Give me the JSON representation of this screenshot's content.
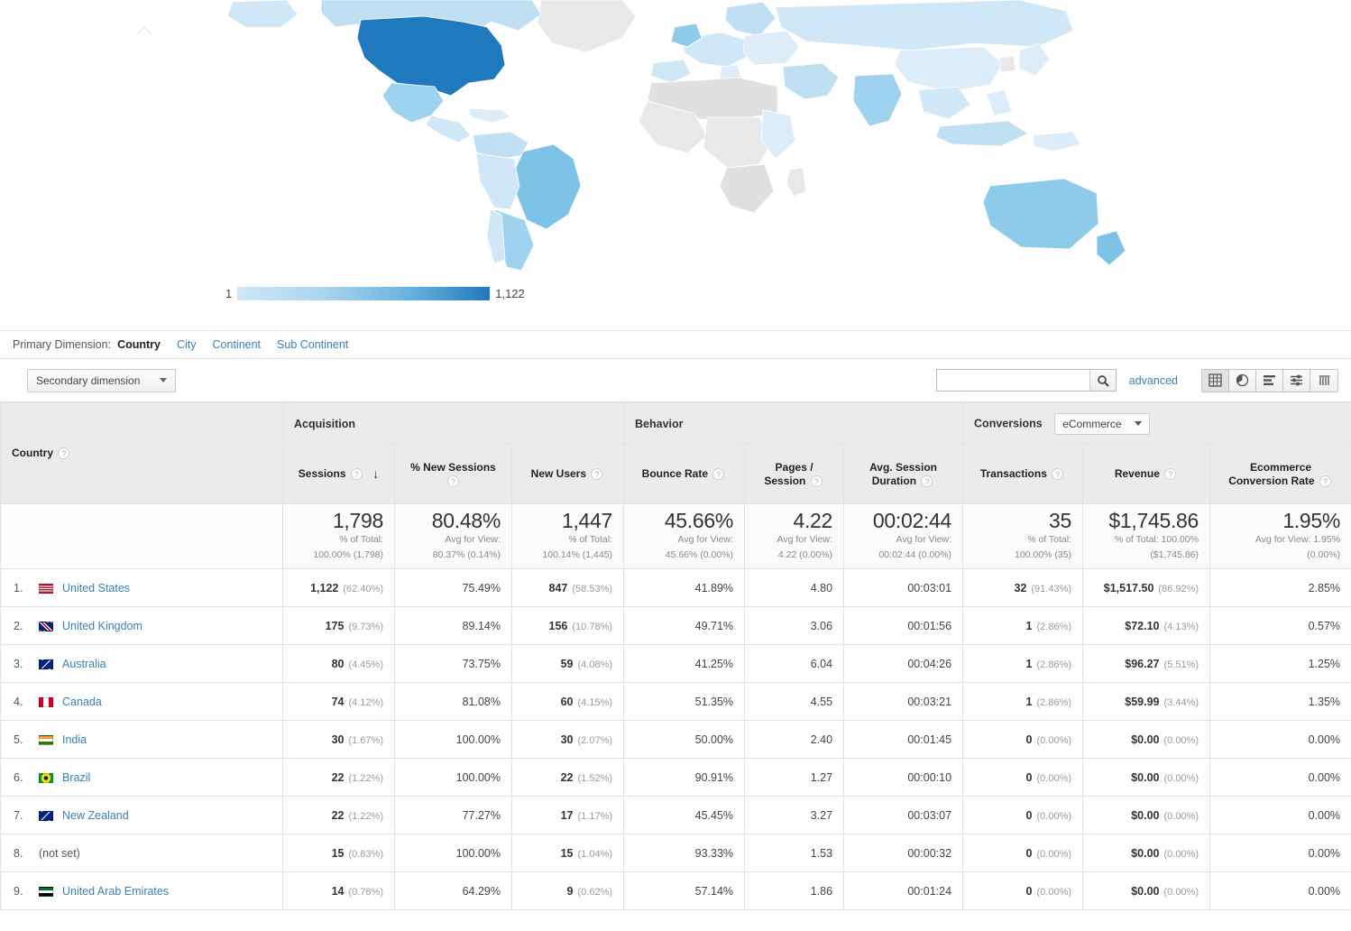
{
  "map": {
    "legend_min": "1",
    "legend_max": "1,122",
    "scale_low_color": "#cfe7f7",
    "scale_high_color": "#1f79bd",
    "no_data_color": "#e8e8e8"
  },
  "primary_dimension": {
    "label": "Primary Dimension:",
    "items": [
      {
        "label": "Country",
        "active": true
      },
      {
        "label": "City",
        "active": false
      },
      {
        "label": "Continent",
        "active": false
      },
      {
        "label": "Sub Continent",
        "active": false
      }
    ]
  },
  "toolbar": {
    "secondary_dimension_label": "Secondary dimension",
    "search_value": "",
    "search_placeholder": "",
    "advanced_label": "advanced",
    "view_icons": [
      {
        "name": "table-view-icon",
        "selected": true
      },
      {
        "name": "pie-chart-view-icon",
        "selected": false
      },
      {
        "name": "performance-view-icon",
        "selected": false
      },
      {
        "name": "comparison-view-icon",
        "selected": false
      },
      {
        "name": "pivot-view-icon",
        "selected": false
      }
    ]
  },
  "table": {
    "dimension_header": "Country",
    "groups": [
      {
        "label": "Acquisition",
        "span": 3
      },
      {
        "label": "Behavior",
        "span": 3
      },
      {
        "label": "Conversions",
        "span": 3,
        "select_value": "eCommerce"
      }
    ],
    "columns": [
      "Sessions",
      "% New Sessions",
      "New Users",
      "Bounce Rate",
      "Pages / Session",
      "Avg. Session Duration",
      "Transactions",
      "Revenue",
      "Ecommerce Conversion Rate"
    ],
    "summary": [
      {
        "value": "1,798",
        "sub1": "% of Total:",
        "sub2": "100.00% (1,798)"
      },
      {
        "value": "80.48%",
        "sub1": "Avg for View:",
        "sub2": "80.37% (0.14%)"
      },
      {
        "value": "1,447",
        "sub1": "% of Total:",
        "sub2": "100.14% (1,445)"
      },
      {
        "value": "45.66%",
        "sub1": "Avg for View:",
        "sub2": "45.66% (0.00%)"
      },
      {
        "value": "4.22",
        "sub1": "Avg for View:",
        "sub2": "4.22 (0.00%)"
      },
      {
        "value": "00:02:44",
        "sub1": "Avg for View:",
        "sub2": "00:02:44 (0.00%)"
      },
      {
        "value": "35",
        "sub1": "% of Total:",
        "sub2": "100.00% (35)"
      },
      {
        "value": "$1,745.86",
        "sub1": "% of Total: 100.00%",
        "sub2": "($1,745.86)"
      },
      {
        "value": "1.95%",
        "sub1": "Avg for View: 1.95%",
        "sub2": "(0.00%)"
      }
    ],
    "rows": [
      {
        "rank": "1.",
        "country": "United States",
        "flag": "us",
        "linked": true,
        "sessions": "1,122",
        "sessions_pct": "(62.40%)",
        "new_sessions_pct": "75.49%",
        "new_users": "847",
        "new_users_pct": "(58.53%)",
        "bounce_rate": "41.89%",
        "pages_session": "4.80",
        "avg_duration": "00:03:01",
        "transactions": "32",
        "transactions_pct": "(91.43%)",
        "revenue": "$1,517.50",
        "revenue_pct": "(86.92%)",
        "ecom_rate": "2.85%"
      },
      {
        "rank": "2.",
        "country": "United Kingdom",
        "flag": "gb",
        "linked": true,
        "sessions": "175",
        "sessions_pct": "(9.73%)",
        "new_sessions_pct": "89.14%",
        "new_users": "156",
        "new_users_pct": "(10.78%)",
        "bounce_rate": "49.71%",
        "pages_session": "3.06",
        "avg_duration": "00:01:56",
        "transactions": "1",
        "transactions_pct": "(2.86%)",
        "revenue": "$72.10",
        "revenue_pct": "(4.13%)",
        "ecom_rate": "0.57%"
      },
      {
        "rank": "3.",
        "country": "Australia",
        "flag": "au",
        "linked": true,
        "sessions": "80",
        "sessions_pct": "(4.45%)",
        "new_sessions_pct": "73.75%",
        "new_users": "59",
        "new_users_pct": "(4.08%)",
        "bounce_rate": "41.25%",
        "pages_session": "6.04",
        "avg_duration": "00:04:26",
        "transactions": "1",
        "transactions_pct": "(2.86%)",
        "revenue": "$96.27",
        "revenue_pct": "(5.51%)",
        "ecom_rate": "1.25%"
      },
      {
        "rank": "4.",
        "country": "Canada",
        "flag": "ca",
        "linked": true,
        "sessions": "74",
        "sessions_pct": "(4.12%)",
        "new_sessions_pct": "81.08%",
        "new_users": "60",
        "new_users_pct": "(4.15%)",
        "bounce_rate": "51.35%",
        "pages_session": "4.55",
        "avg_duration": "00:03:21",
        "transactions": "1",
        "transactions_pct": "(2.86%)",
        "revenue": "$59.99",
        "revenue_pct": "(3.44%)",
        "ecom_rate": "1.35%"
      },
      {
        "rank": "5.",
        "country": "India",
        "flag": "in",
        "linked": true,
        "sessions": "30",
        "sessions_pct": "(1.67%)",
        "new_sessions_pct": "100.00%",
        "new_users": "30",
        "new_users_pct": "(2.07%)",
        "bounce_rate": "50.00%",
        "pages_session": "2.40",
        "avg_duration": "00:01:45",
        "transactions": "0",
        "transactions_pct": "(0.00%)",
        "revenue": "$0.00",
        "revenue_pct": "(0.00%)",
        "ecom_rate": "0.00%"
      },
      {
        "rank": "6.",
        "country": "Brazil",
        "flag": "br",
        "linked": true,
        "sessions": "22",
        "sessions_pct": "(1.22%)",
        "new_sessions_pct": "100.00%",
        "new_users": "22",
        "new_users_pct": "(1.52%)",
        "bounce_rate": "90.91%",
        "pages_session": "1.27",
        "avg_duration": "00:00:10",
        "transactions": "0",
        "transactions_pct": "(0.00%)",
        "revenue": "$0.00",
        "revenue_pct": "(0.00%)",
        "ecom_rate": "0.00%"
      },
      {
        "rank": "7.",
        "country": "New Zealand",
        "flag": "nz",
        "linked": true,
        "sessions": "22",
        "sessions_pct": "(1.22%)",
        "new_sessions_pct": "77.27%",
        "new_users": "17",
        "new_users_pct": "(1.17%)",
        "bounce_rate": "45.45%",
        "pages_session": "3.27",
        "avg_duration": "00:03:07",
        "transactions": "0",
        "transactions_pct": "(0.00%)",
        "revenue": "$0.00",
        "revenue_pct": "(0.00%)",
        "ecom_rate": "0.00%"
      },
      {
        "rank": "8.",
        "country": "(not set)",
        "flag": "",
        "linked": false,
        "sessions": "15",
        "sessions_pct": "(0.83%)",
        "new_sessions_pct": "100.00%",
        "new_users": "15",
        "new_users_pct": "(1.04%)",
        "bounce_rate": "93.33%",
        "pages_session": "1.53",
        "avg_duration": "00:00:32",
        "transactions": "0",
        "transactions_pct": "(0.00%)",
        "revenue": "$0.00",
        "revenue_pct": "(0.00%)",
        "ecom_rate": "0.00%"
      },
      {
        "rank": "9.",
        "country": "United Arab Emirates",
        "flag": "ae",
        "linked": true,
        "sessions": "14",
        "sessions_pct": "(0.78%)",
        "new_sessions_pct": "64.29%",
        "new_users": "9",
        "new_users_pct": "(0.62%)",
        "bounce_rate": "57.14%",
        "pages_session": "1.86",
        "avg_duration": "00:01:24",
        "transactions": "0",
        "transactions_pct": "(0.00%)",
        "revenue": "$0.00",
        "revenue_pct": "(0.00%)",
        "ecom_rate": "0.00%"
      }
    ]
  },
  "chart_data": {
    "type": "heatmap",
    "title": "Sessions by Country (World Map)",
    "metric": "Sessions",
    "scale_min": 1,
    "scale_max": 1122,
    "categories": [
      "United States",
      "United Kingdom",
      "Australia",
      "Canada",
      "India",
      "Brazil",
      "New Zealand",
      "(not set)",
      "United Arab Emirates"
    ],
    "values": [
      1122,
      175,
      80,
      74,
      30,
      22,
      22,
      15,
      14
    ],
    "legend_position": "bottom-left",
    "grid": false
  }
}
